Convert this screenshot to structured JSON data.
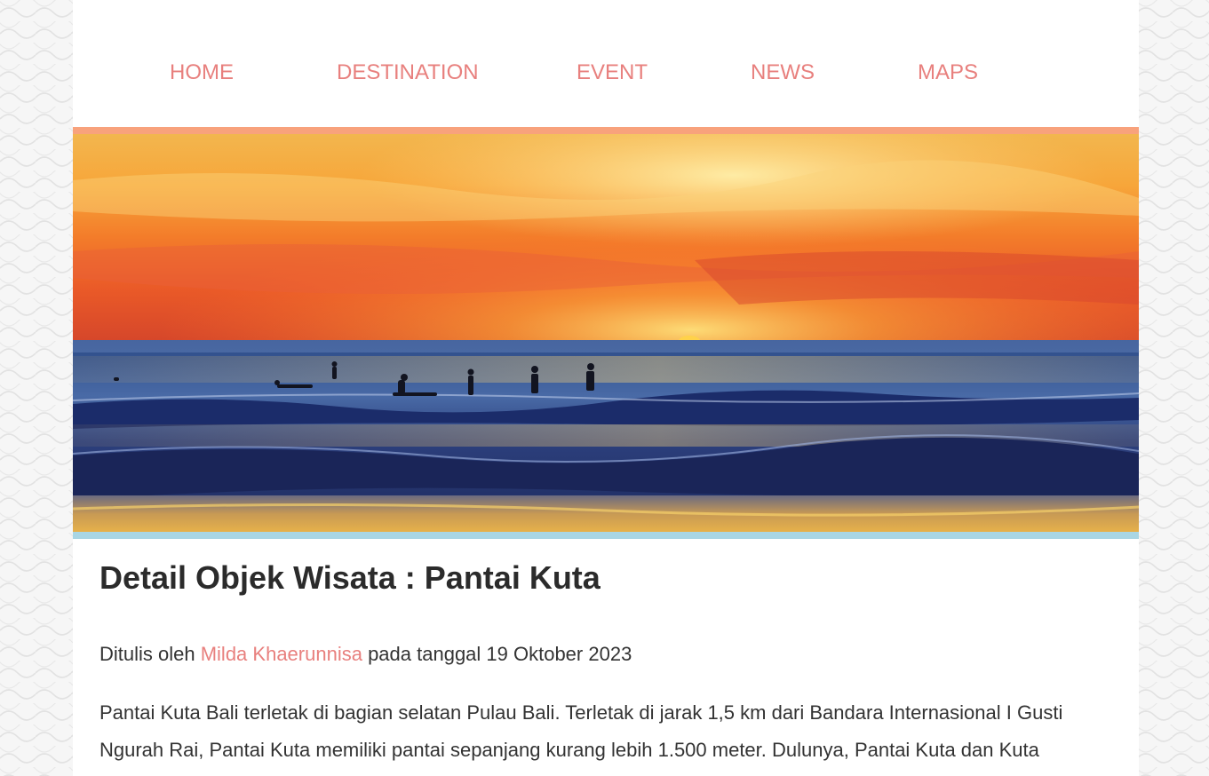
{
  "nav": {
    "items": [
      {
        "label": "HOME"
      },
      {
        "label": "DESTINATION"
      },
      {
        "label": "EVENT"
      },
      {
        "label": "NEWS"
      },
      {
        "label": "MAPS"
      }
    ]
  },
  "hero": {
    "image_subject": "sunset over the sea with surfers at Pantai Kuta",
    "accent_top_color": "#f8a27c",
    "accent_bottom_color": "#a9d6e4"
  },
  "article": {
    "title": "Detail Objek Wisata : Pantai Kuta",
    "meta_prefix": "Ditulis oleh ",
    "author": "Milda Khaerunnisa",
    "meta_suffix": " pada tanggal 19 Oktober 2023",
    "body": "Pantai Kuta Bali terletak di bagian selatan Pulau Bali. Terletak di jarak 1,5 km dari Bandara Internasional I Gusti Ngurah Rai, Pantai Kuta memiliki pantai sepanjang kurang lebih 1.500 meter. Dulunya, Pantai Kuta dan Kuta"
  },
  "colors": {
    "nav_link": "#e8807e",
    "author_link": "#e8807e",
    "text": "#333333"
  }
}
